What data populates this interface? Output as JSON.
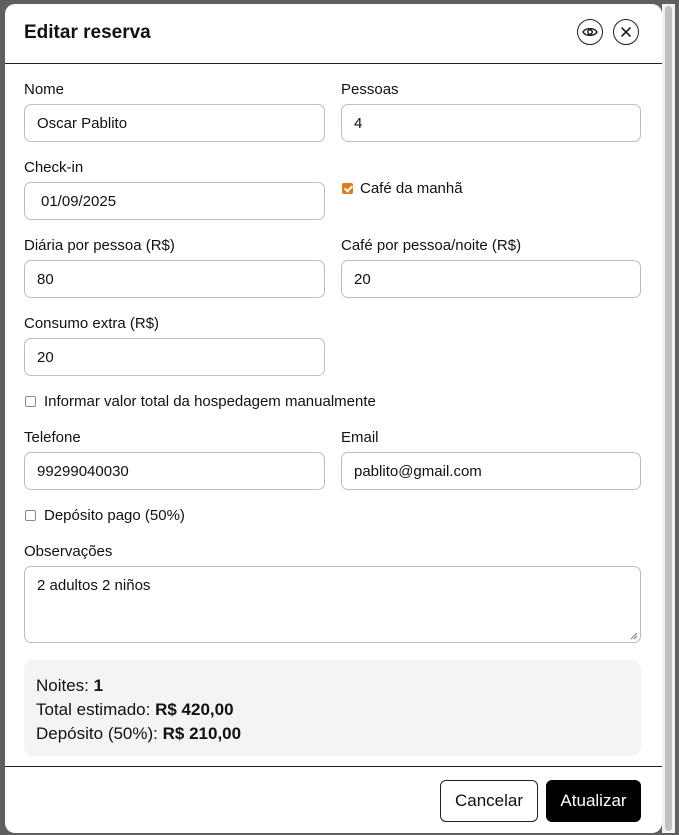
{
  "modal": {
    "title": "Editar reserva",
    "preview_icon": "eye-icon",
    "close_icon": "close-icon"
  },
  "form": {
    "nome": {
      "label": "Nome",
      "value": "Oscar Pablito"
    },
    "pessoas": {
      "label": "Pessoas",
      "value": "4"
    },
    "checkin": {
      "label": "Check-in",
      "value": "01/09/2025"
    },
    "cafe_da_manha": {
      "label": "Café da manhã",
      "checked": true
    },
    "diaria": {
      "label": "Diária por pessoa (R$)",
      "value": "80"
    },
    "cafe_noite": {
      "label": "Café por pessoa/noite (R$)",
      "value": "20"
    },
    "consumo_extra": {
      "label": "Consumo extra (R$)",
      "value": "20"
    },
    "manual_total": {
      "label": "Informar valor total da hospedagem manualmente",
      "checked": false
    },
    "telefone": {
      "label": "Telefone",
      "value": "99299040030"
    },
    "email": {
      "label": "Email",
      "value": "pablito@gmail.com"
    },
    "deposito_pago": {
      "label": "Depósito pago (50%)",
      "checked": false
    },
    "observacoes": {
      "label": "Observações",
      "value": "2 adultos 2 niños"
    }
  },
  "summary": {
    "noites_label": "Noites:",
    "noites_value": "1",
    "total_label": "Total estimado:",
    "total_value": "R$ 420,00",
    "deposito_label": "Depósito (50%):",
    "deposito_value": "R$ 210,00"
  },
  "footer": {
    "cancel_label": "Cancelar",
    "submit_label": "Atualizar"
  },
  "colors": {
    "accent_checkbox": "#e07a1f",
    "primary_button": "#000000"
  }
}
